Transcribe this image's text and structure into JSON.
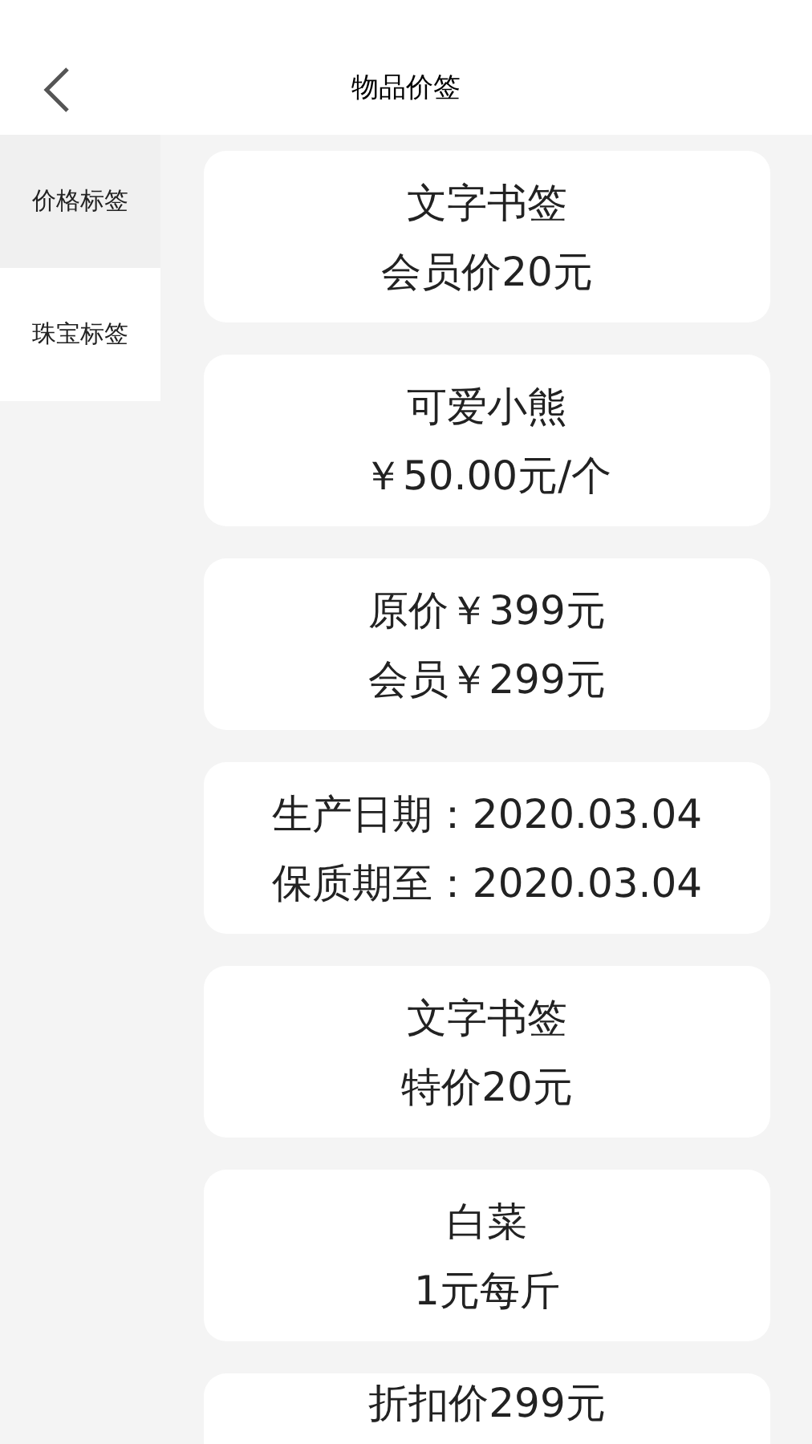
{
  "header": {
    "title": "物品价签"
  },
  "sidebar": {
    "items": [
      {
        "label": "价格标签",
        "selected": true
      },
      {
        "label": "珠宝标签",
        "selected": false
      }
    ]
  },
  "cards": [
    {
      "lines": [
        "文字书签",
        "会员价20元"
      ]
    },
    {
      "lines": [
        "可爱小熊",
        "￥50.00元/个"
      ]
    },
    {
      "lines": [
        "原价￥399元",
        "会员￥299元"
      ]
    },
    {
      "lines": [
        "生产日期：2020.03.04",
        "保质期至：2020.03.04"
      ]
    },
    {
      "lines": [
        "文字书签",
        "特价20元"
      ]
    },
    {
      "lines": [
        "白菜",
        "1元每斤"
      ]
    },
    {
      "lines": [
        "折扣价299元"
      ]
    }
  ]
}
